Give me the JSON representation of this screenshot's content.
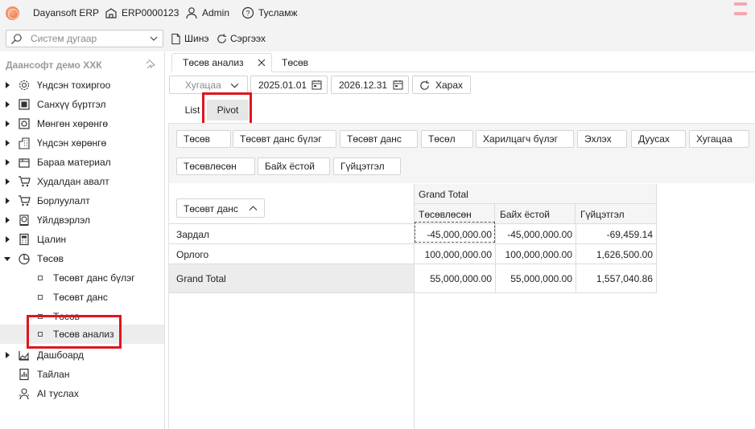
{
  "header": {
    "app_name": "Dayansoft ERP",
    "company_code": "ERP0000123",
    "user": "Admin",
    "help": "Тусламж"
  },
  "toolbar": {
    "search_placeholder": "Систем дугаар",
    "new_label": "Шинэ",
    "refresh_label": "Сэргээх"
  },
  "sidebar": {
    "company": "Даансофт демо ХХК",
    "items": [
      {
        "label": "Үндсэн тохиргоо",
        "icon": "gear-icon"
      },
      {
        "label": "Санхүү бүртгэл",
        "icon": "ledger-icon"
      },
      {
        "label": "Мөнгөн хөрөнгө",
        "icon": "cash-icon"
      },
      {
        "label": "Үндсэн хөрөнгө",
        "icon": "building-icon"
      },
      {
        "label": "Бараа материал",
        "icon": "box-icon"
      },
      {
        "label": "Худалдан авалт",
        "icon": "cart-icon"
      },
      {
        "label": "Борлуулалт",
        "icon": "cart-icon"
      },
      {
        "label": "Үйлдвэрлэл",
        "icon": "factory-icon"
      },
      {
        "label": "Цалин",
        "icon": "calculator-icon"
      },
      {
        "label": "Төсөв",
        "icon": "pie-chart-icon"
      }
    ],
    "budget_sub": [
      "Төсөвт данс бүлэг",
      "Төсөвт данс",
      "Төсөв",
      "Төсөв анализ"
    ],
    "items_after": [
      {
        "label": "Дашбоард",
        "icon": "dashboard-icon"
      },
      {
        "label": "Тайлан",
        "icon": "report-icon"
      },
      {
        "label": "AI туслах",
        "icon": "robot-icon"
      }
    ]
  },
  "tabs": [
    "Төсөв анализ",
    "Төсөв"
  ],
  "filters": {
    "period_select": "Хугацаа",
    "date_from": "2025.01.01",
    "date_to": "2026.12.31",
    "refresh": "Харах"
  },
  "view_tabs": [
    "List",
    "Pivot"
  ],
  "pivot": {
    "filter_fields_row1": [
      "Төсөв",
      "Төсөвт данс бүлэг",
      "Төсөвт данс",
      "Төсөл",
      "Харилцагч бүлэг",
      "Эхлэх",
      "Дуусах",
      "Хугацаа"
    ],
    "data_fields": [
      "Төсөвлөсөн",
      "Байх ёстой",
      "Гүйцэтгэл"
    ],
    "row_field": "Төсөвт данс",
    "col_total": "Grand Total",
    "measures": [
      "Төсөвлөсөн",
      "Байх ёстой",
      "Гүйцэтгэл"
    ],
    "rows": [
      {
        "label": "Зардал",
        "values": [
          "-45,000,000.00",
          "-45,000,000.00",
          "-69,459.14"
        ]
      },
      {
        "label": "Орлого",
        "values": [
          "100,000,000.00",
          "100,000,000.00",
          "1,626,500.00"
        ]
      }
    ],
    "grand_total": {
      "label": "Grand Total",
      "values": [
        "55,000,000.00",
        "55,000,000.00",
        "1,557,040.86"
      ]
    }
  }
}
